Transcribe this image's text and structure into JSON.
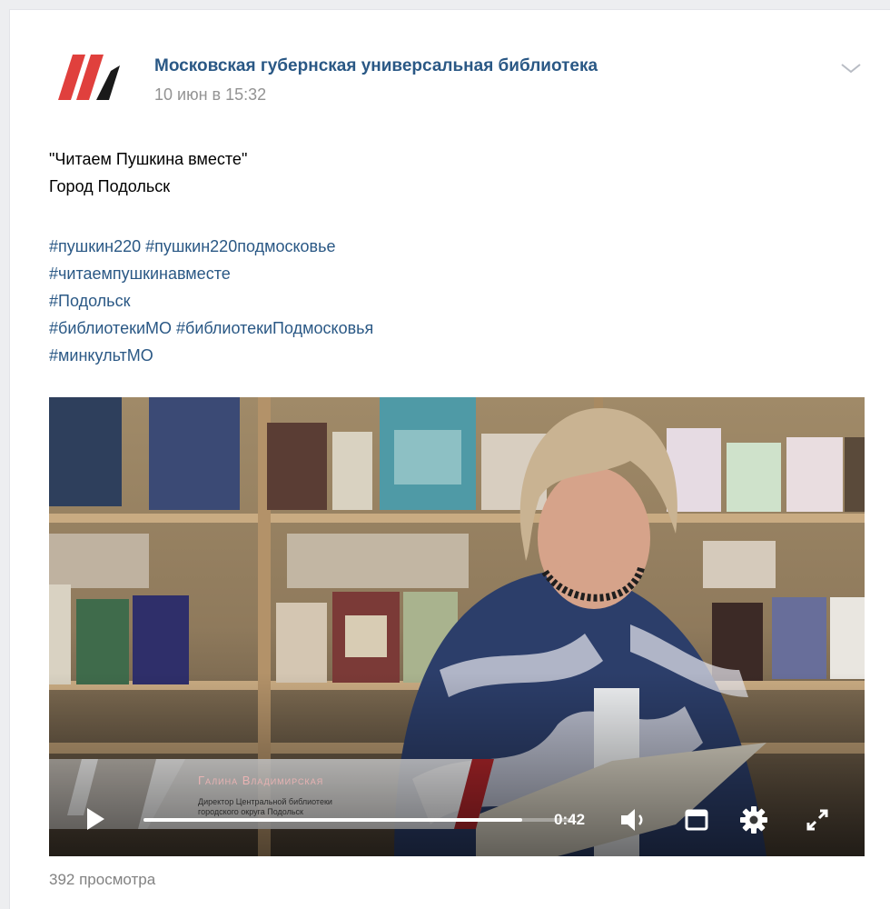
{
  "post": {
    "author": "Московская губернская универсальная библиотека",
    "date": "10 июн в 15:32",
    "text_lines": [
      "\"Читаем Пушкина вместе\"",
      "Город Подольск"
    ],
    "hashtag_lines": [
      "#пушкин220 #пушкин220подмосковье",
      "#читаемпушкинавместе",
      "#Подольск",
      "#библиотекиМО #библиотекиПодмосковья",
      "#минкультМО"
    ],
    "views": "392 просмотра"
  },
  "video": {
    "lower_third_name": "Галина Владимирская",
    "lower_third_role_line1": "Директор Центральной библиотеки",
    "lower_third_role_line2": "городского округа Подольск",
    "time": "0:42",
    "progress": 0.88
  },
  "icons": [
    "logo-icon",
    "chevron-down-icon",
    "play-icon",
    "volume-icon",
    "miniplayer-icon",
    "settings-icon",
    "fullscreen-icon"
  ],
  "colors": {
    "link": "#2a5885",
    "logo_red": "#e0403d",
    "logo_black": "#1a1a1a"
  }
}
